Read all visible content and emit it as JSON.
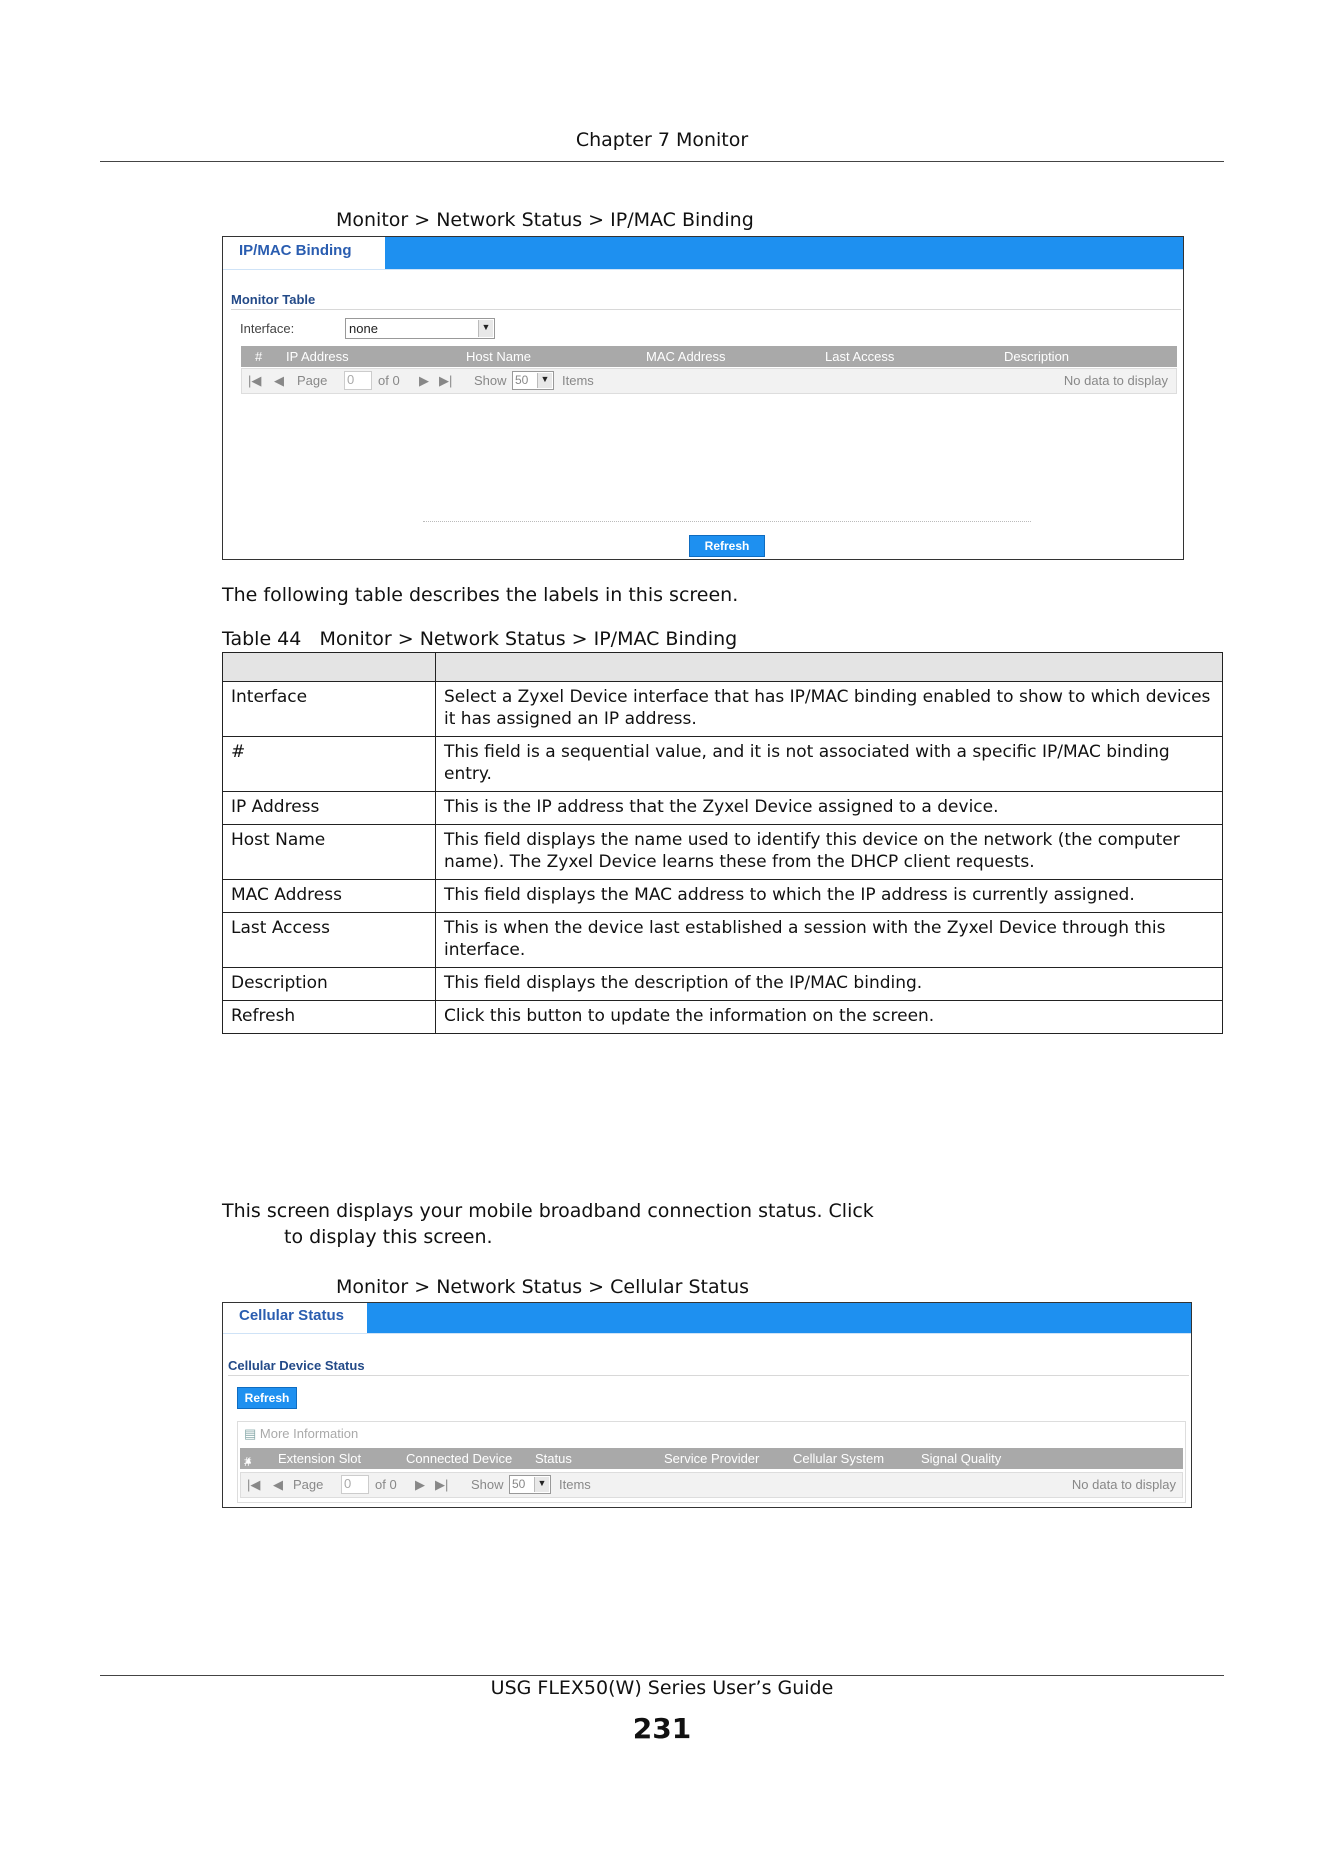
{
  "header": {
    "chapter": "Chapter 7 Monitor"
  },
  "figure1": {
    "caption": "Monitor > Network Status > IP/MAC Binding",
    "tab_label": "IP/MAC Binding",
    "section": "Monitor Table",
    "interface_label": "Interface:",
    "interface_value": "none",
    "columns": [
      "#",
      "IP Address",
      "Host Name",
      "MAC Address",
      "Last Access",
      "Description"
    ],
    "pager": {
      "page_label": "Page",
      "page_value": "0",
      "of_label": "of 0",
      "show_label": "Show",
      "show_value": "50",
      "items_label": "Items",
      "no_data": "No data to display"
    },
    "refresh_label": "Refresh"
  },
  "intro": "The following table describes the labels in this screen.",
  "table": {
    "caption": "Table 44   Monitor > Network Status > IP/MAC Binding",
    "rows": [
      {
        "label": "Interface",
        "description": "Select a Zyxel Device interface that has IP/MAC binding enabled to show to which devices it has assigned an IP address."
      },
      {
        "label": "#",
        "description": "This field is a sequential value, and it is not associated with a specific IP/MAC binding entry."
      },
      {
        "label": "IP Address",
        "description": "This is the IP address that the Zyxel Device assigned to a device."
      },
      {
        "label": "Host Name",
        "description": "This field displays the name used to identify this device on the network (the computer name). The Zyxel Device learns these from the DHCP client requests."
      },
      {
        "label": "MAC Address",
        "description": "This field displays the MAC address to which the IP address is currently assigned."
      },
      {
        "label": "Last Access",
        "description": "This is when the device last established a session with the Zyxel Device through this interface."
      },
      {
        "label": "Description",
        "description": "This field displays the description of the IP/MAC binding."
      },
      {
        "label": "Refresh",
        "description": "Click this button to update the information on the screen."
      }
    ]
  },
  "cellular_intro": {
    "line1": "This screen displays your mobile broadband connection status. Click",
    "line2": "to display this screen."
  },
  "figure2": {
    "caption": "Monitor > Network Status > Cellular Status",
    "tab_label": "Cellular Status",
    "section": "Cellular Device Status",
    "refresh_label": "Refresh",
    "more_info": "More Information",
    "columns": [
      "#",
      "Extension Slot",
      "Connected Device",
      "Status",
      "Service Provider",
      "Cellular System",
      "Signal Quality"
    ],
    "pager": {
      "page_label": "Page",
      "page_value": "0",
      "of_label": "of 0",
      "show_label": "Show",
      "show_value": "50",
      "items_label": "Items",
      "no_data": "No data to display"
    }
  },
  "footer": {
    "guide": "USG FLEX50(W) Series User’s Guide",
    "page_number": "231"
  }
}
